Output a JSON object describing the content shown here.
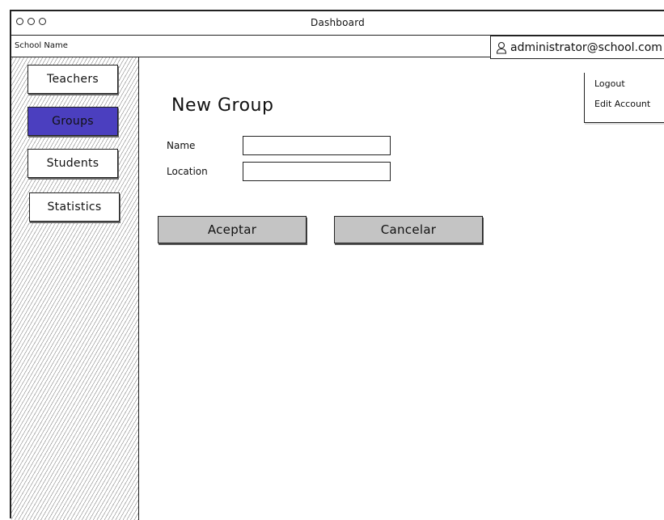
{
  "window": {
    "title": "Dashboard"
  },
  "navbar": {
    "school_name": "School Name",
    "account_email": "administrator@school.com"
  },
  "account_menu": {
    "items": [
      "Logout",
      "Edit Account"
    ]
  },
  "sidebar": {
    "items": [
      {
        "label": "Teachers",
        "active": false
      },
      {
        "label": "Groups",
        "active": true
      },
      {
        "label": "Students",
        "active": false
      },
      {
        "label": "Statistics",
        "active": false
      }
    ]
  },
  "form": {
    "title": "New Group",
    "fields": [
      {
        "label": "Name",
        "value": ""
      },
      {
        "label": "Location",
        "value": ""
      }
    ],
    "accept_label": "Aceptar",
    "cancel_label": "Cancelar"
  },
  "colors": {
    "active_nav": "#4b3fbf",
    "button_fill": "#c4c4c4"
  }
}
